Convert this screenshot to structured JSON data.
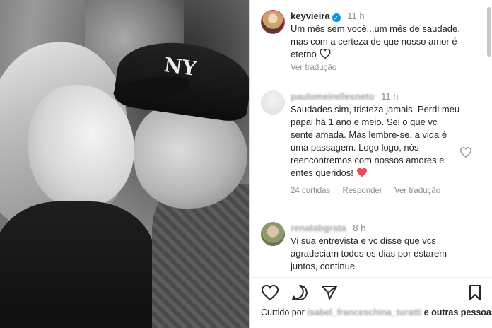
{
  "post": {
    "author": "keyvieira",
    "time": "11 h",
    "caption": "Um mês sem você...um mês de saudade, mas com a certeza de que nosso amor é eterno",
    "translate": "Ver tradução"
  },
  "comments": [
    {
      "user": "paulomeirellesneto",
      "time": "11 h",
      "text": "Saudades sim, tristeza jamais. Perdi meu papai há 1 ano e meio. Sei o que vc sente amada. Mas lembre-se, a vida é uma passagem. Logo logo, nós reencontremos com nossos amores e entes queridos!",
      "likes": "24 curtidas",
      "reply": "Responder",
      "translate": "Ver tradução"
    },
    {
      "user": "renatabgrata",
      "time": "8 h",
      "text": "Vi sua entrevista e vc disse que vcs agradeciam todos os dias por estarem juntos, continue"
    }
  ],
  "actions": {
    "liked_prefix": "Curtido por",
    "liked_user": "isabel_franceschina_turatti",
    "liked_suffix": "e outras pessoas"
  },
  "photo": {
    "cap_logo": "NY"
  },
  "colors": {
    "heart_red": "#ed4956",
    "verified_blue": "#0095f6",
    "muted_text": "#8e8e8e"
  }
}
